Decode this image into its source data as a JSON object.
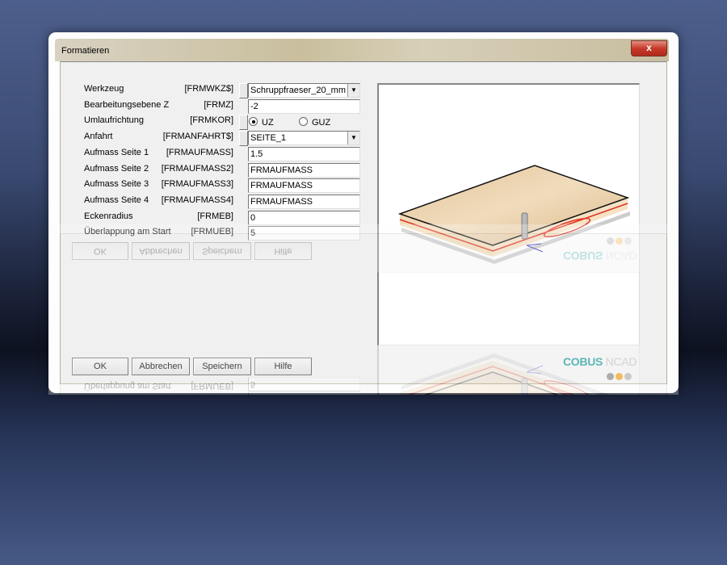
{
  "window": {
    "title": "Formatieren",
    "close_label": "x"
  },
  "form": {
    "rows": [
      {
        "label": "Werkzeug",
        "code": "[FRMWKZ$]",
        "value": "Schruppfraeser_20_mm",
        "type": "dropdown"
      },
      {
        "label": "Bearbeitungsebene Z",
        "code": "[FRMZ]",
        "value": "-2",
        "type": "text"
      },
      {
        "label": "Umlaufrichtung",
        "code": "[FRMKOR]",
        "type": "radio"
      },
      {
        "label": "Anfahrt",
        "code": "[FRMANFAHRT$]",
        "value": "SEITE_1",
        "type": "dropdown"
      },
      {
        "label": "Aufmass Seite 1",
        "code": "[FRMAUFMASS]",
        "value": "1.5",
        "type": "text"
      },
      {
        "label": "Aufmass Seite 2",
        "code": "[FRMAUFMASS2]",
        "value": "FRMAUFMASS",
        "type": "text"
      },
      {
        "label": "Aufmass Seite 3",
        "code": "[FRMAUFMASS3]",
        "value": "FRMAUFMASS",
        "type": "text"
      },
      {
        "label": "Aufmass Seite 4",
        "code": "[FRMAUFMASS4]",
        "value": "FRMAUFMASS",
        "type": "text"
      },
      {
        "label": "Eckenradius",
        "code": "[FRMEB]",
        "value": "0",
        "type": "text"
      },
      {
        "label": "Überlappung am Start",
        "code": "[FRMUEB]",
        "value": "5",
        "type": "text"
      }
    ],
    "radio": {
      "options": [
        "UZ",
        "GUZ"
      ],
      "selected": "UZ"
    }
  },
  "buttons": {
    "ok": "OK",
    "cancel": "Abbrechen",
    "save": "Speichern",
    "help": "Hilfe"
  },
  "logo": {
    "part1": "COBUS",
    "part2": "NCAD",
    "dot_colors": [
      "#8c8c8c",
      "#f0a020",
      "#b5b5b5"
    ]
  },
  "colors": {
    "accent": "#1d9a9a",
    "close": "#c6392a"
  }
}
